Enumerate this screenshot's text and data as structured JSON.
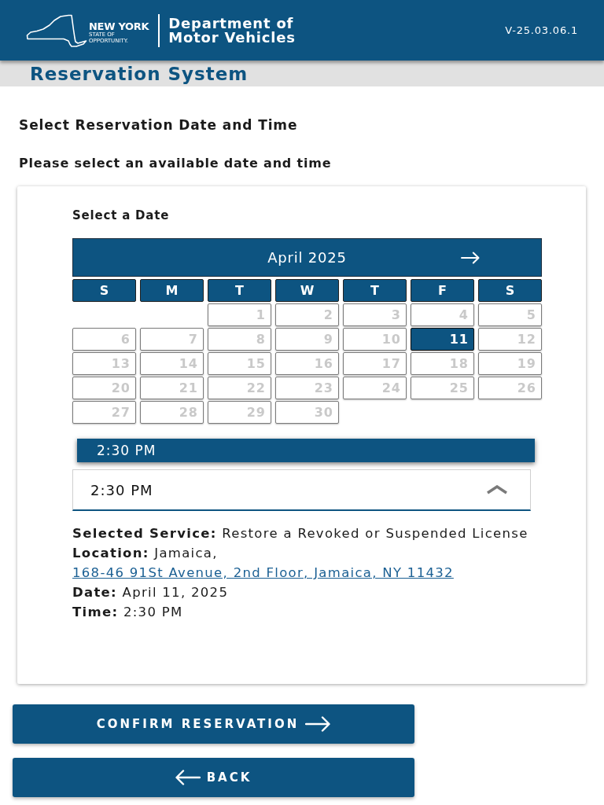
{
  "header": {
    "logo": {
      "wordmark": "NEW YORK",
      "tagline": [
        "STATE OF",
        "OPPORTUNITY."
      ]
    },
    "department": [
      "Department of",
      "Motor Vehicles"
    ],
    "version": "V-25.03.06.1"
  },
  "subheader": {
    "title": "Reservation System"
  },
  "page": {
    "heading": "Select Reservation Date and Time",
    "subheading": "Please select an available date and time"
  },
  "date_picker": {
    "label": "Select a Date",
    "month": "April 2025",
    "weekdays": [
      "S",
      "M",
      "T",
      "W",
      "T",
      "F",
      "S"
    ],
    "days": [
      {
        "kind": "blank"
      },
      {
        "kind": "blank"
      },
      {
        "kind": "day",
        "label": "1",
        "selected": false,
        "disabled": true
      },
      {
        "kind": "day",
        "label": "2",
        "selected": false,
        "disabled": true
      },
      {
        "kind": "day",
        "label": "3",
        "selected": false,
        "disabled": true
      },
      {
        "kind": "day",
        "label": "4",
        "selected": false,
        "disabled": true
      },
      {
        "kind": "day",
        "label": "5",
        "selected": false,
        "disabled": true
      },
      {
        "kind": "day",
        "label": "6",
        "selected": false,
        "disabled": true
      },
      {
        "kind": "day",
        "label": "7",
        "selected": false,
        "disabled": true
      },
      {
        "kind": "day",
        "label": "8",
        "selected": false,
        "disabled": true
      },
      {
        "kind": "day",
        "label": "9",
        "selected": false,
        "disabled": true
      },
      {
        "kind": "day",
        "label": "10",
        "selected": false,
        "disabled": true
      },
      {
        "kind": "day",
        "label": "11",
        "selected": true,
        "disabled": false
      },
      {
        "kind": "day",
        "label": "12",
        "selected": false,
        "disabled": true
      },
      {
        "kind": "day",
        "label": "13",
        "selected": false,
        "disabled": true
      },
      {
        "kind": "day",
        "label": "14",
        "selected": false,
        "disabled": true
      },
      {
        "kind": "day",
        "label": "15",
        "selected": false,
        "disabled": true
      },
      {
        "kind": "day",
        "label": "16",
        "selected": false,
        "disabled": true
      },
      {
        "kind": "day",
        "label": "17",
        "selected": false,
        "disabled": true
      },
      {
        "kind": "day",
        "label": "18",
        "selected": false,
        "disabled": true
      },
      {
        "kind": "day",
        "label": "19",
        "selected": false,
        "disabled": true
      },
      {
        "kind": "day",
        "label": "20",
        "selected": false,
        "disabled": true
      },
      {
        "kind": "day",
        "label": "21",
        "selected": false,
        "disabled": true
      },
      {
        "kind": "day",
        "label": "22",
        "selected": false,
        "disabled": true
      },
      {
        "kind": "day",
        "label": "23",
        "selected": false,
        "disabled": true
      },
      {
        "kind": "day",
        "label": "24",
        "selected": false,
        "disabled": true
      },
      {
        "kind": "day",
        "label": "25",
        "selected": false,
        "disabled": true
      },
      {
        "kind": "day",
        "label": "26",
        "selected": false,
        "disabled": true
      },
      {
        "kind": "day",
        "label": "27",
        "selected": false,
        "disabled": true
      },
      {
        "kind": "day",
        "label": "28",
        "selected": false,
        "disabled": true
      },
      {
        "kind": "day",
        "label": "29",
        "selected": false,
        "disabled": true
      },
      {
        "kind": "day",
        "label": "30",
        "selected": false,
        "disabled": true
      }
    ]
  },
  "time_select": {
    "expanded": true,
    "value": "2:30 PM",
    "options": [
      {
        "label": "2:30 PM",
        "selected": true
      }
    ]
  },
  "summary": [
    {
      "label": "Selected Service:",
      "value": "Restore a Revoked or Suspended License"
    },
    {
      "label": "Location:",
      "value": "Jamaica,",
      "link": "168-46 91St Avenue, 2nd Floor, Jamaica, NY 11432"
    },
    {
      "label": "Date:",
      "value": "April 11, 2025"
    },
    {
      "label": "Time:",
      "value": "2:30 PM"
    }
  ],
  "buttons": [
    {
      "kind": "forward",
      "label": "CONFIRM RESERVATION"
    },
    {
      "kind": "back",
      "label": "BACK"
    }
  ]
}
